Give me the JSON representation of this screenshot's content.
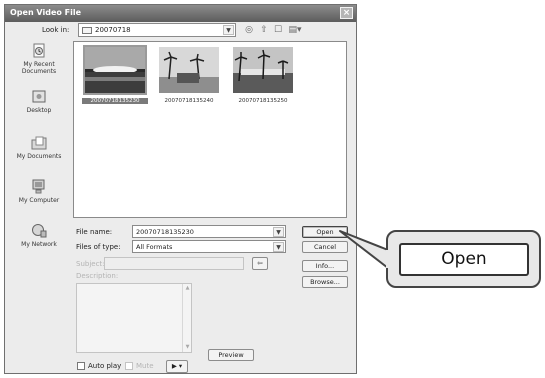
{
  "window": {
    "title": "Open Video File",
    "close_glyph": "×"
  },
  "lookin": {
    "label": "Look in:",
    "value": "20070718"
  },
  "places": [
    {
      "label_line1": "My Recent",
      "label_line2": "Documents",
      "icon": "recent-documents-icon"
    },
    {
      "label_line1": "Desktop",
      "label_line2": "",
      "icon": "desktop-icon"
    },
    {
      "label_line1": "My Documents",
      "label_line2": "",
      "icon": "my-documents-icon"
    },
    {
      "label_line1": "My Computer",
      "label_line2": "",
      "icon": "my-computer-icon"
    },
    {
      "label_line1": "My Network",
      "label_line2": "",
      "icon": "my-network-icon"
    }
  ],
  "files": [
    {
      "name": "20070718135230",
      "selected": true
    },
    {
      "name": "20070718135240",
      "selected": false
    },
    {
      "name": "20070718135250",
      "selected": false
    }
  ],
  "filename": {
    "label": "File name:",
    "value": "20070718135230"
  },
  "filetype": {
    "label": "Files of type:",
    "value": "All Formats"
  },
  "subject": {
    "label": "Subject:",
    "value": ""
  },
  "description": {
    "label": "Description:"
  },
  "buttons": {
    "open": "Open",
    "cancel": "Cancel",
    "info": "Info...",
    "browse": "Browse...",
    "preview": "Preview"
  },
  "options": {
    "auto_play": "Auto play",
    "mute": "Mute",
    "play_glyph": "▶ ▾"
  },
  "callout": {
    "open_label": "Open"
  },
  "colors": {
    "title_bar": "#6e6e6e",
    "selection": "#7a7a7a"
  }
}
